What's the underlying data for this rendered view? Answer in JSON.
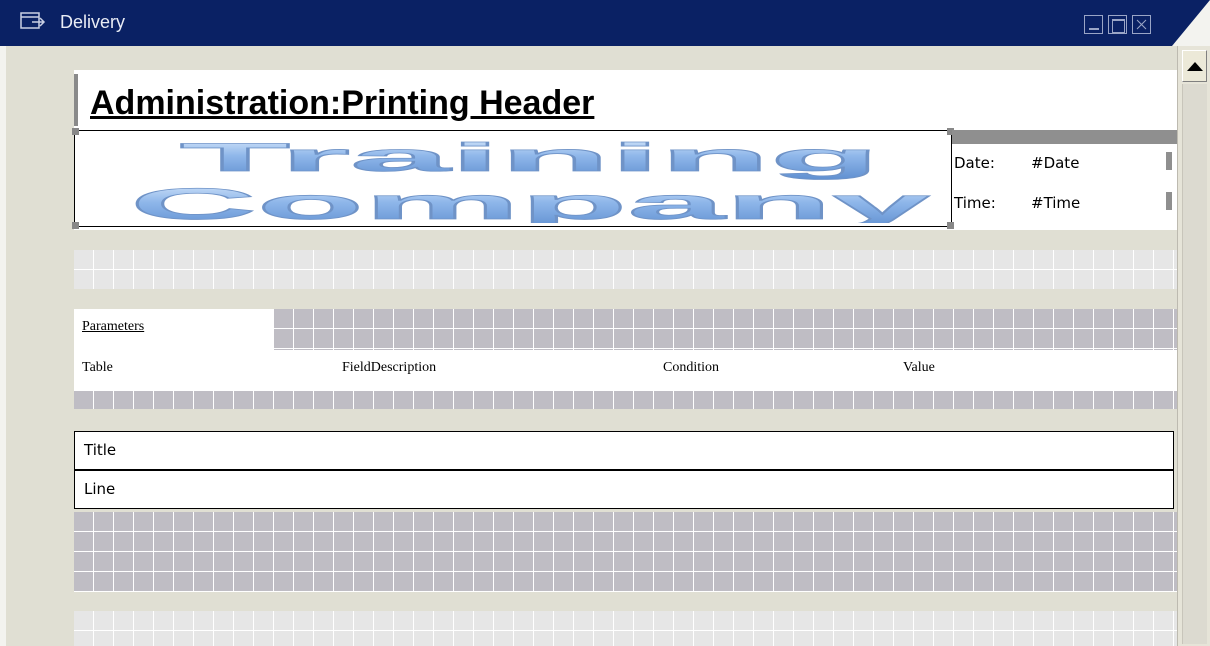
{
  "window": {
    "title": "Delivery",
    "icon": "window-icon",
    "buttons": [
      "minimize-icon",
      "maximize-icon",
      "close-icon"
    ]
  },
  "header": {
    "title": "Administration:Printing Header",
    "logo_line1": "Training",
    "logo_line2": "Company",
    "date_label": "Date:",
    "date_value": "#Date",
    "time_label": "Time:",
    "time_value": "#Time"
  },
  "parameters": {
    "label": "Parameters",
    "columns": [
      "Table",
      "FieldDescription",
      "Condition",
      "Value"
    ]
  },
  "boxes": {
    "title": "Title",
    "line": "Line"
  },
  "colors": {
    "titlebar": "#0a2164",
    "workspace": "#e0dfd3",
    "logo_fill": "#8fb7ea"
  }
}
